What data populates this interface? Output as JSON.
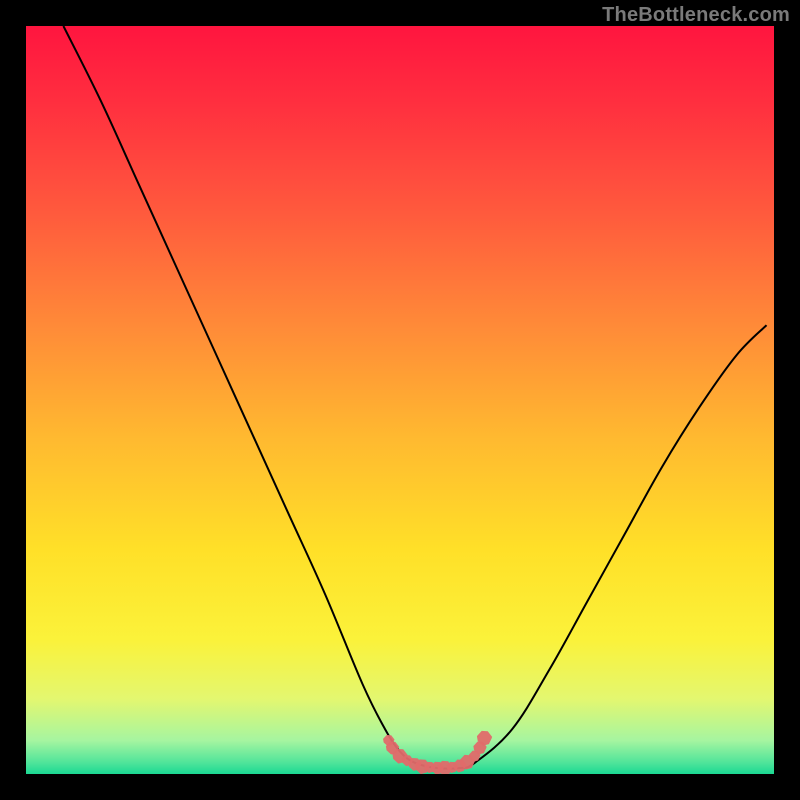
{
  "watermark": "TheBottleneck.com",
  "chart_data": {
    "type": "line",
    "title": "",
    "xlabel": "",
    "ylabel": "",
    "xlim": [
      0,
      100
    ],
    "ylim": [
      0,
      100
    ],
    "background_gradient": {
      "stops": [
        {
          "offset": 0.0,
          "color": "#ff153f"
        },
        {
          "offset": 0.1,
          "color": "#ff2e3f"
        },
        {
          "offset": 0.25,
          "color": "#ff5a3d"
        },
        {
          "offset": 0.4,
          "color": "#ff8a38"
        },
        {
          "offset": 0.55,
          "color": "#ffb930"
        },
        {
          "offset": 0.7,
          "color": "#ffe028"
        },
        {
          "offset": 0.82,
          "color": "#fbf23a"
        },
        {
          "offset": 0.9,
          "color": "#e3f770"
        },
        {
          "offset": 0.955,
          "color": "#a6f5a0"
        },
        {
          "offset": 0.985,
          "color": "#4fe49a"
        },
        {
          "offset": 1.0,
          "color": "#1bd993"
        }
      ]
    },
    "series": [
      {
        "name": "bottleneck-curve",
        "color": "#000000",
        "x": [
          5,
          10,
          15,
          20,
          25,
          30,
          35,
          40,
          45,
          48,
          50,
          52,
          55,
          58,
          60,
          65,
          70,
          75,
          80,
          85,
          90,
          95,
          99
        ],
        "y": [
          100,
          90,
          79,
          68,
          57,
          46,
          35,
          24,
          12,
          6,
          3,
          1.5,
          0.8,
          0.8,
          1.5,
          6,
          14,
          23,
          32,
          41,
          49,
          56,
          60
        ]
      }
    ],
    "markers": {
      "name": "trough-markers",
      "color": "#e06a6a",
      "points": [
        {
          "x": 48.5,
          "y": 4.5
        },
        {
          "x": 49.0,
          "y": 3.5
        },
        {
          "x": 50.0,
          "y": 2.4
        },
        {
          "x": 51.0,
          "y": 1.8
        },
        {
          "x": 52.0,
          "y": 1.3
        },
        {
          "x": 53.0,
          "y": 1.0
        },
        {
          "x": 54.0,
          "y": 0.9
        },
        {
          "x": 55.0,
          "y": 0.8
        },
        {
          "x": 56.0,
          "y": 0.8
        },
        {
          "x": 57.0,
          "y": 0.9
        },
        {
          "x": 58.0,
          "y": 1.1
        },
        {
          "x": 59.0,
          "y": 1.6
        },
        {
          "x": 60.0,
          "y": 2.4
        },
        {
          "x": 60.7,
          "y": 3.5
        },
        {
          "x": 61.3,
          "y": 4.8
        }
      ]
    }
  }
}
